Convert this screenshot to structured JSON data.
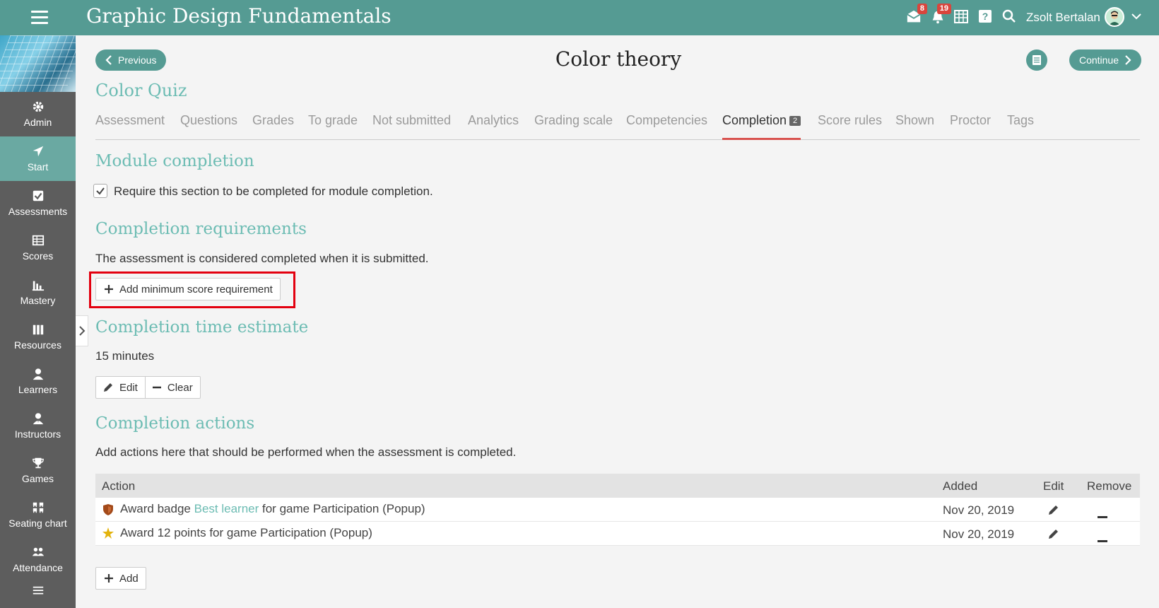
{
  "header": {
    "app_title": "Graphic Design Fundamentals",
    "mail_badge": "8",
    "notifications_badge": "19",
    "user_name": "Zsolt Bertalan"
  },
  "sidebar": {
    "items": [
      {
        "label": "Admin",
        "icon": "gear-icon"
      },
      {
        "label": "Start",
        "icon": "arrow-icon"
      },
      {
        "label": "Assessments",
        "icon": "checkbox-icon"
      },
      {
        "label": "Scores",
        "icon": "table-icon"
      },
      {
        "label": "Mastery",
        "icon": "bar-chart-icon"
      },
      {
        "label": "Resources",
        "icon": "books-icon"
      },
      {
        "label": "Learners",
        "icon": "person-icon"
      },
      {
        "label": "Instructors",
        "icon": "instructor-icon"
      },
      {
        "label": "Games",
        "icon": "trophy-icon"
      },
      {
        "label": "Seating chart",
        "icon": "seating-icon"
      },
      {
        "label": "Attendance",
        "icon": "attendance-icon"
      }
    ],
    "active": "Start"
  },
  "nav": {
    "previous_label": "Previous",
    "continue_label": "Continue",
    "page_title": "Color theory"
  },
  "quiz_title": "Color Quiz",
  "tabs": [
    {
      "label": "Assessment"
    },
    {
      "label": "Questions"
    },
    {
      "label": "Grades"
    },
    {
      "label": "To grade"
    },
    {
      "label": "Not submitted"
    },
    {
      "label": "Analytics"
    },
    {
      "label": "Grading scale"
    },
    {
      "label": "Competencies"
    },
    {
      "label": "Completion",
      "badge": "2"
    },
    {
      "label": "Score rules"
    },
    {
      "label": "Shown"
    },
    {
      "label": "Proctor"
    },
    {
      "label": "Tags"
    }
  ],
  "active_tab": "Completion",
  "module_completion": {
    "title": "Module completion",
    "checkbox_label": "Require this section to be completed for module completion.",
    "checked": true
  },
  "requirements": {
    "title": "Completion requirements",
    "description": "The assessment is considered completed when it is submitted.",
    "add_button": "Add minimum score requirement"
  },
  "time_estimate": {
    "title": "Completion time estimate",
    "value": "15 minutes",
    "edit_label": "Edit",
    "clear_label": "Clear"
  },
  "actions": {
    "title": "Completion actions",
    "description": "Add actions here that should be performed when the assessment is completed.",
    "columns": {
      "action": "Action",
      "added": "Added",
      "edit": "Edit",
      "remove": "Remove"
    },
    "rows": [
      {
        "prefix": "Award badge ",
        "link": "Best learner",
        "suffix": " for game Participation (Popup)",
        "added": "Nov 20, 2019",
        "icon": "badge-shield-icon"
      },
      {
        "prefix": "Award 12 points for game Participation (Popup)",
        "link": "",
        "suffix": "",
        "added": "Nov 20, 2019",
        "icon": "star-icon"
      }
    ],
    "add_label": "Add"
  }
}
